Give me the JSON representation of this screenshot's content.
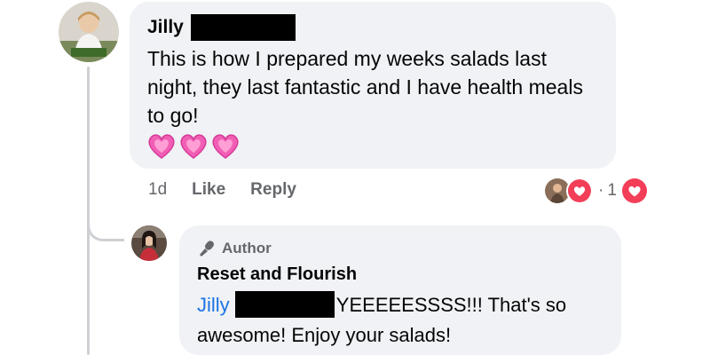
{
  "comment": {
    "author": "Jilly",
    "text": "This is how I prepared my weeks salads last night, they last fantastic and I have health meals to go!",
    "emoji": [
      "heart-emoji",
      "heart-emoji",
      "heart-emoji"
    ],
    "time": "1d",
    "like_label": "Like",
    "reply_label": "Reply",
    "reaction_separator": "·",
    "reaction_count": "1"
  },
  "reply": {
    "badge": "Author",
    "author": "Reset and Flourish",
    "mention": "Jilly",
    "text": "YEEEEESSSS!!! That's so awesome! Enjoy your salads!"
  },
  "colors": {
    "bubble": "#f0f2f5",
    "muted": "#65676b",
    "mention": "#1b74e4",
    "reaction_heart": "#f33e58"
  }
}
